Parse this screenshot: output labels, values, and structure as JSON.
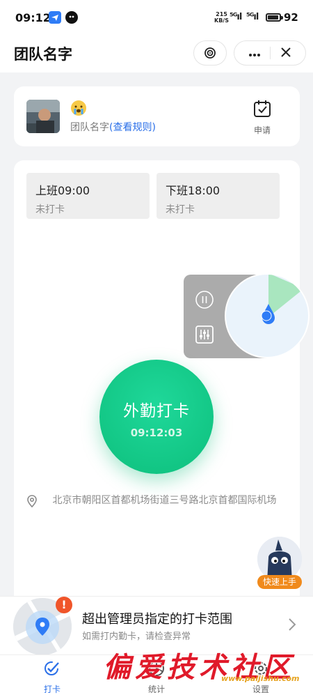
{
  "status_bar": {
    "time": "09:12",
    "network_speed_value": "215",
    "network_speed_unit": "KB/S",
    "signal_1": "⁵ᴳıl",
    "signal_2": "⁵ᴳıl",
    "battery": "92"
  },
  "nav": {
    "title": "团队名字",
    "icons": [
      "target-icon",
      "more-icon",
      "close-icon"
    ]
  },
  "team": {
    "name": "团队名字",
    "rules_link": "(查看规则)",
    "apply_label": "申请",
    "emoji": "crying-face"
  },
  "shifts": [
    {
      "time": "上班09:00",
      "status": "未打卡"
    },
    {
      "time": "下班18:00",
      "status": "未打卡"
    }
  ],
  "punch": {
    "label": "外勤打卡",
    "time": "09:12:03",
    "color": "#12c985"
  },
  "location": {
    "address": "北京市朝阳区首都机场街道三号路北京首都国际机场"
  },
  "quick_start": {
    "label": "快速上手"
  },
  "banner": {
    "title": "超出管理员指定的打卡范围",
    "subtitle": "如需打内勤卡，请检查异常",
    "badge": "!"
  },
  "tabs": [
    {
      "label": "打卡",
      "active": true
    },
    {
      "label": "统计",
      "active": false
    },
    {
      "label": "设置",
      "active": false
    }
  ],
  "watermark": {
    "text": "偏爱技术社区",
    "url": "www.paijishu.com"
  },
  "colors": {
    "accent": "#2a6fe8",
    "punch_green": "#12c985",
    "warning": "#f0552a",
    "quick_start_orange": "#f08a1c"
  }
}
